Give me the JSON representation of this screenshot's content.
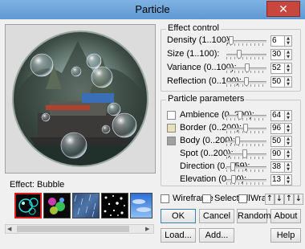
{
  "window": {
    "title": "Particle",
    "close_glyph": "✕"
  },
  "effect_control": {
    "label": "Effect control",
    "sliders": [
      {
        "label": "Density (1..100):",
        "value": "6",
        "fraction": 0.06
      },
      {
        "label": "Size (1..100):",
        "value": "30",
        "fraction": 0.3
      },
      {
        "label": "Variance (0..100):",
        "value": "52",
        "fraction": 0.52
      },
      {
        "label": "Reflection (0..100):",
        "value": "50",
        "fraction": 0.5
      }
    ]
  },
  "particle_params": {
    "label": "Particle parameters",
    "sliders": [
      {
        "label": "Ambience (0..200):",
        "value": "64",
        "fraction": 0.32,
        "swatch": "#ffffff"
      },
      {
        "label": "Border (0..200):",
        "value": "96",
        "fraction": 0.48,
        "swatch": "#e8e0b8"
      },
      {
        "label": "Body (0..200):",
        "value": "50",
        "fraction": 0.25,
        "swatch": "#a0a0a0"
      },
      {
        "label": "Spot (0..200):",
        "value": "90",
        "fraction": 0.45
      },
      {
        "label": "Direction (0..359):",
        "value": "38",
        "fraction": 0.11
      },
      {
        "label": "Elevation (0..90):",
        "value": "13",
        "fraction": 0.14
      }
    ]
  },
  "effect": {
    "label": "Effect: Bubble"
  },
  "options": {
    "wireframe": "Wireframe",
    "select_all": "Select all",
    "wrap": "Wrap",
    "arrows": [
      "↑",
      "↓",
      "↑",
      "↓"
    ]
  },
  "buttons": {
    "ok": "OK",
    "cancel": "Cancel",
    "random": "Random",
    "about": "About",
    "load": "Load...",
    "add": "Add...",
    "help": "Help"
  },
  "colors": {
    "title_bar": "#6aa0d4",
    "close": "#c7463d",
    "selected_effect_border": "#d42020"
  }
}
